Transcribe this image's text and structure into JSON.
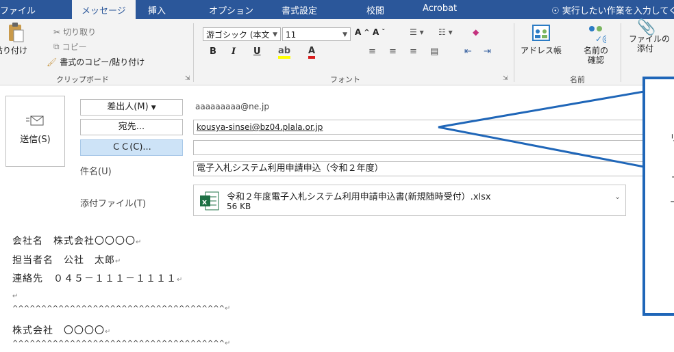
{
  "ribbon": {
    "tabs": [
      "ファイル",
      "メッセージ",
      "挿入",
      "オプション",
      "書式設定",
      "校閲",
      "Acrobat"
    ],
    "tell_me": "実行したい作業を入力してくださ",
    "clipboard": {
      "paste": "貼り付け",
      "cut": "切り取り",
      "copy": "コピー",
      "format_painter": "書式のコピー/貼り付け",
      "group_label": "クリップボード"
    },
    "font": {
      "font_name": "游ゴシック (本文",
      "font_size": "11",
      "bold": "B",
      "italic": "I",
      "underline": "U",
      "group_label": "フォント"
    },
    "names": {
      "address_book": "アドレス帳",
      "check_names_1": "名前の",
      "check_names_2": "確認",
      "group_label": "名前"
    },
    "include": {
      "attach_1": "ファイルの",
      "attach_2": "添付"
    }
  },
  "message": {
    "send_label": "送信(S)",
    "from_button": "差出人(M)",
    "from_value": "aaaaaaaaa@ne.jp",
    "to_button": "宛先...",
    "to_value": "kousya-sinsei@bz04.plala.or.jp",
    "cc_button": "ＣＣ(C)...",
    "cc_value": "",
    "subject_label": "件名(U)",
    "subject_value": "電子入札システム利用申請申込（令和２年度）",
    "attach_label": "添付ファイル(T)",
    "attachment_name": "令和２年度電子入札システム利用申請申込書(新規随時受付）.xlsx",
    "attachment_size": "56 KB"
  },
  "body_lines": [
    "会社名　株式会社〇〇〇〇",
    "担当者名　公社　太郎",
    "連絡先　０４５－１１１－１１１１",
    "",
    "^^^^^^^^^^^^^^^^^^^^^^^^^^^^^^^^^^^^^",
    "株式会社　〇〇〇〇",
    "^^^^^^^^^^^^^^^^^^^^^^^^^^^^^^^^^^^^^"
  ],
  "colors": {
    "ribbon_blue": "#2b579a",
    "callout_blue": "#1f66b8",
    "cc_highlight": "#cde3f7"
  },
  "icons": [
    "paste-icon",
    "scissors-icon",
    "copy-icon",
    "format-painter-icon",
    "address-book-icon",
    "check-names-icon",
    "paperclip-icon",
    "send-icon",
    "excel-file-icon",
    "lightbulb-icon"
  ]
}
